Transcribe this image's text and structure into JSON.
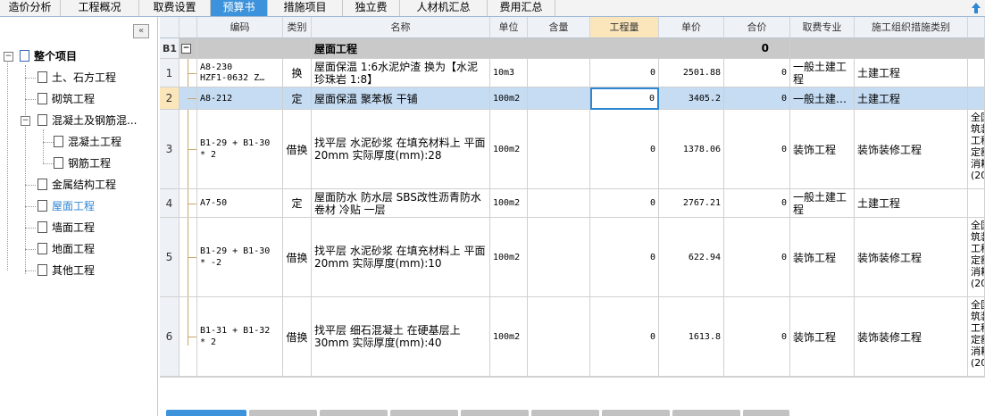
{
  "tabs": [
    {
      "label": "造价分析"
    },
    {
      "label": "工程概况"
    },
    {
      "label": "取费设置"
    },
    {
      "label": "预算书"
    },
    {
      "label": "措施项目"
    },
    {
      "label": "独立费"
    },
    {
      "label": "人材机汇总"
    },
    {
      "label": "费用汇总"
    }
  ],
  "active_tab": "预算书",
  "tree": {
    "root": "整个项目",
    "items": [
      {
        "label": "土、石方工程"
      },
      {
        "label": "砌筑工程"
      },
      {
        "label": "混凝土及钢筋混..."
      },
      {
        "label": "混凝土工程"
      },
      {
        "label": "钢筋工程"
      },
      {
        "label": "金属结构工程"
      },
      {
        "label": "屋面工程"
      },
      {
        "label": "墙面工程"
      },
      {
        "label": "地面工程"
      },
      {
        "label": "其他工程"
      }
    ],
    "active": "屋面工程"
  },
  "columns": [
    "编码",
    "类别",
    "名称",
    "单位",
    "含量",
    "工程量",
    "单价",
    "合价",
    "取费专业",
    "施工组织措施类别"
  ],
  "group": {
    "code": "B1",
    "name": "屋面工程",
    "total": "0",
    "toggle": "−"
  },
  "rows": [
    {
      "no": "1",
      "code": "A8-230\nHZF1-0632 Z…",
      "type": "换",
      "name": "屋面保温 1:6水泥炉渣  换为【水泥珍珠岩 1:8】",
      "unit": "10m3",
      "content": "",
      "qty": "0",
      "price": "2501.88",
      "total": "0",
      "fee": "一般土建工程",
      "measure": "土建工程",
      "extra": ""
    },
    {
      "no": "2",
      "code": "A8-212",
      "type": "定",
      "name": "屋面保温 聚苯板 干铺",
      "unit": "100m2",
      "content": "",
      "qty": "0",
      "price": "3405.2",
      "total": "0",
      "fee": "一般土建…",
      "measure": "土建工程",
      "extra": ""
    },
    {
      "no": "3",
      "code": "B1-29 + B1-30\n* 2",
      "type": "借换",
      "name": "找平层 水泥砂浆 在填充材料上 平面 20mm  实际厚度(mm):28",
      "unit": "100m2",
      "content": "",
      "qty": "0",
      "price": "1378.06",
      "total": "0",
      "fee": "装饰工程",
      "measure": "装饰装修工程",
      "extra": "全国\n筑装\n工程\n定额\n消耗\n(20"
    },
    {
      "no": "4",
      "code": "A7-50",
      "type": "定",
      "name": "屋面防水 防水层 SBS改性沥青防水卷材 冷贴 一层",
      "unit": "100m2",
      "content": "",
      "qty": "0",
      "price": "2767.21",
      "total": "0",
      "fee": "一般土建工程",
      "measure": "土建工程",
      "extra": ""
    },
    {
      "no": "5",
      "code": "B1-29 + B1-30\n* -2",
      "type": "借换",
      "name": "找平层 水泥砂浆 在填充材料上 平面 20mm  实际厚度(mm):10",
      "unit": "100m2",
      "content": "",
      "qty": "0",
      "price": "622.94",
      "total": "0",
      "fee": "装饰工程",
      "measure": "装饰装修工程",
      "extra": "全国\n筑装\n工程\n定额\n消耗\n(20"
    },
    {
      "no": "6",
      "code": "B1-31 + B1-32\n* 2",
      "type": "借换",
      "name": "找平层 细石混凝土 在硬基层上 30mm  实际厚度(mm):40",
      "unit": "100m2",
      "content": "",
      "qty": "0",
      "price": "1613.8",
      "total": "0",
      "fee": "装饰工程",
      "measure": "装饰装修工程",
      "extra": "全国\n筑装\n工程\n定额\n消耗\n(20"
    }
  ],
  "colors": {
    "accent": "#3d93db",
    "selected_row": "#c5dcf3",
    "header_bg": "#eef1f5",
    "group_bg": "#c9c9c9"
  }
}
